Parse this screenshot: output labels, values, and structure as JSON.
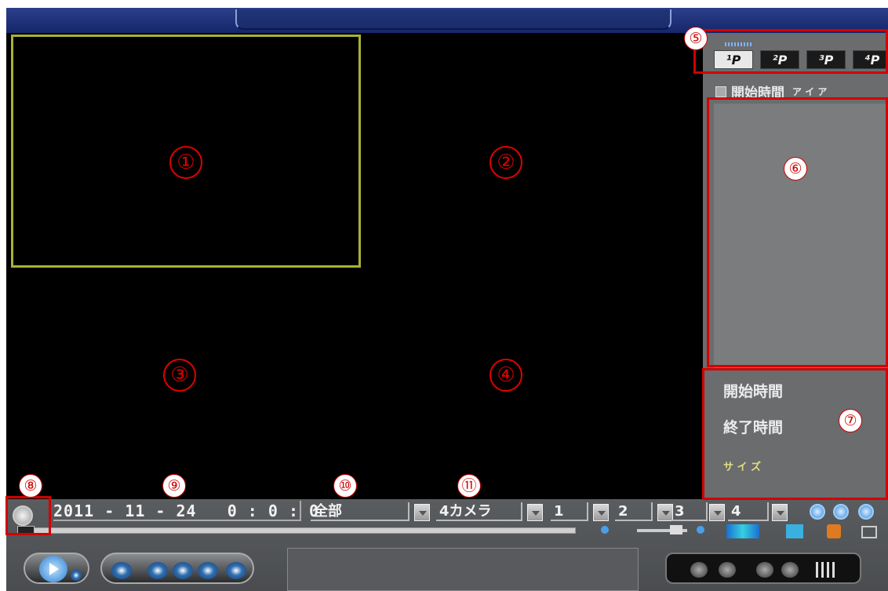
{
  "callouts": [
    "⑤",
    "⑥",
    "⑦",
    "⑧",
    "⑨",
    "⑩",
    "⑪"
  ],
  "panes": [
    "①",
    "②",
    "③",
    "④"
  ],
  "layout_tabs": [
    "¹P",
    "²P",
    "³P",
    "⁴P"
  ],
  "list_header": {
    "label": "開始時間",
    "extra": "ア イ ア"
  },
  "info": {
    "start_label": "開始時間",
    "end_label": "終了時間",
    "size_label": "サ イ ズ"
  },
  "toolbar": {
    "datetime": "2011 - 11 - 24   0 : 0 : 0",
    "type_select": "全部",
    "camera_select": "4カメラ",
    "channel_1": "1",
    "channel_2": "2",
    "channel_3": "3",
    "channel_4": "4"
  },
  "colors": {
    "selection": "#a8b234",
    "callout": "#d40000",
    "titlebar": "#1c2e78"
  }
}
